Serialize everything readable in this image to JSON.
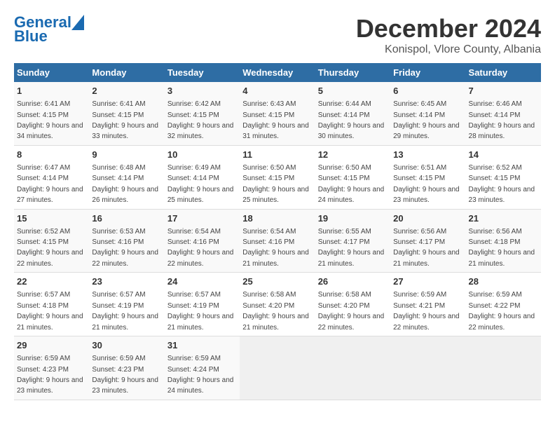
{
  "logo": {
    "line1": "General",
    "line2": "Blue"
  },
  "title": "December 2024",
  "location": "Konispol, Vlore County, Albania",
  "days_header": [
    "Sunday",
    "Monday",
    "Tuesday",
    "Wednesday",
    "Thursday",
    "Friday",
    "Saturday"
  ],
  "weeks": [
    [
      {
        "day": "1",
        "sunrise": "Sunrise: 6:41 AM",
        "sunset": "Sunset: 4:15 PM",
        "daylight": "Daylight: 9 hours and 34 minutes."
      },
      {
        "day": "2",
        "sunrise": "Sunrise: 6:41 AM",
        "sunset": "Sunset: 4:15 PM",
        "daylight": "Daylight: 9 hours and 33 minutes."
      },
      {
        "day": "3",
        "sunrise": "Sunrise: 6:42 AM",
        "sunset": "Sunset: 4:15 PM",
        "daylight": "Daylight: 9 hours and 32 minutes."
      },
      {
        "day": "4",
        "sunrise": "Sunrise: 6:43 AM",
        "sunset": "Sunset: 4:15 PM",
        "daylight": "Daylight: 9 hours and 31 minutes."
      },
      {
        "day": "5",
        "sunrise": "Sunrise: 6:44 AM",
        "sunset": "Sunset: 4:14 PM",
        "daylight": "Daylight: 9 hours and 30 minutes."
      },
      {
        "day": "6",
        "sunrise": "Sunrise: 6:45 AM",
        "sunset": "Sunset: 4:14 PM",
        "daylight": "Daylight: 9 hours and 29 minutes."
      },
      {
        "day": "7",
        "sunrise": "Sunrise: 6:46 AM",
        "sunset": "Sunset: 4:14 PM",
        "daylight": "Daylight: 9 hours and 28 minutes."
      }
    ],
    [
      {
        "day": "8",
        "sunrise": "Sunrise: 6:47 AM",
        "sunset": "Sunset: 4:14 PM",
        "daylight": "Daylight: 9 hours and 27 minutes."
      },
      {
        "day": "9",
        "sunrise": "Sunrise: 6:48 AM",
        "sunset": "Sunset: 4:14 PM",
        "daylight": "Daylight: 9 hours and 26 minutes."
      },
      {
        "day": "10",
        "sunrise": "Sunrise: 6:49 AM",
        "sunset": "Sunset: 4:14 PM",
        "daylight": "Daylight: 9 hours and 25 minutes."
      },
      {
        "day": "11",
        "sunrise": "Sunrise: 6:50 AM",
        "sunset": "Sunset: 4:15 PM",
        "daylight": "Daylight: 9 hours and 25 minutes."
      },
      {
        "day": "12",
        "sunrise": "Sunrise: 6:50 AM",
        "sunset": "Sunset: 4:15 PM",
        "daylight": "Daylight: 9 hours and 24 minutes."
      },
      {
        "day": "13",
        "sunrise": "Sunrise: 6:51 AM",
        "sunset": "Sunset: 4:15 PM",
        "daylight": "Daylight: 9 hours and 23 minutes."
      },
      {
        "day": "14",
        "sunrise": "Sunrise: 6:52 AM",
        "sunset": "Sunset: 4:15 PM",
        "daylight": "Daylight: 9 hours and 23 minutes."
      }
    ],
    [
      {
        "day": "15",
        "sunrise": "Sunrise: 6:52 AM",
        "sunset": "Sunset: 4:15 PM",
        "daylight": "Daylight: 9 hours and 22 minutes."
      },
      {
        "day": "16",
        "sunrise": "Sunrise: 6:53 AM",
        "sunset": "Sunset: 4:16 PM",
        "daylight": "Daylight: 9 hours and 22 minutes."
      },
      {
        "day": "17",
        "sunrise": "Sunrise: 6:54 AM",
        "sunset": "Sunset: 4:16 PM",
        "daylight": "Daylight: 9 hours and 22 minutes."
      },
      {
        "day": "18",
        "sunrise": "Sunrise: 6:54 AM",
        "sunset": "Sunset: 4:16 PM",
        "daylight": "Daylight: 9 hours and 21 minutes."
      },
      {
        "day": "19",
        "sunrise": "Sunrise: 6:55 AM",
        "sunset": "Sunset: 4:17 PM",
        "daylight": "Daylight: 9 hours and 21 minutes."
      },
      {
        "day": "20",
        "sunrise": "Sunrise: 6:56 AM",
        "sunset": "Sunset: 4:17 PM",
        "daylight": "Daylight: 9 hours and 21 minutes."
      },
      {
        "day": "21",
        "sunrise": "Sunrise: 6:56 AM",
        "sunset": "Sunset: 4:18 PM",
        "daylight": "Daylight: 9 hours and 21 minutes."
      }
    ],
    [
      {
        "day": "22",
        "sunrise": "Sunrise: 6:57 AM",
        "sunset": "Sunset: 4:18 PM",
        "daylight": "Daylight: 9 hours and 21 minutes."
      },
      {
        "day": "23",
        "sunrise": "Sunrise: 6:57 AM",
        "sunset": "Sunset: 4:19 PM",
        "daylight": "Daylight: 9 hours and 21 minutes."
      },
      {
        "day": "24",
        "sunrise": "Sunrise: 6:57 AM",
        "sunset": "Sunset: 4:19 PM",
        "daylight": "Daylight: 9 hours and 21 minutes."
      },
      {
        "day": "25",
        "sunrise": "Sunrise: 6:58 AM",
        "sunset": "Sunset: 4:20 PM",
        "daylight": "Daylight: 9 hours and 21 minutes."
      },
      {
        "day": "26",
        "sunrise": "Sunrise: 6:58 AM",
        "sunset": "Sunset: 4:20 PM",
        "daylight": "Daylight: 9 hours and 22 minutes."
      },
      {
        "day": "27",
        "sunrise": "Sunrise: 6:59 AM",
        "sunset": "Sunset: 4:21 PM",
        "daylight": "Daylight: 9 hours and 22 minutes."
      },
      {
        "day": "28",
        "sunrise": "Sunrise: 6:59 AM",
        "sunset": "Sunset: 4:22 PM",
        "daylight": "Daylight: 9 hours and 22 minutes."
      }
    ],
    [
      {
        "day": "29",
        "sunrise": "Sunrise: 6:59 AM",
        "sunset": "Sunset: 4:23 PM",
        "daylight": "Daylight: 9 hours and 23 minutes."
      },
      {
        "day": "30",
        "sunrise": "Sunrise: 6:59 AM",
        "sunset": "Sunset: 4:23 PM",
        "daylight": "Daylight: 9 hours and 23 minutes."
      },
      {
        "day": "31",
        "sunrise": "Sunrise: 6:59 AM",
        "sunset": "Sunset: 4:24 PM",
        "daylight": "Daylight: 9 hours and 24 minutes."
      },
      null,
      null,
      null,
      null
    ]
  ]
}
